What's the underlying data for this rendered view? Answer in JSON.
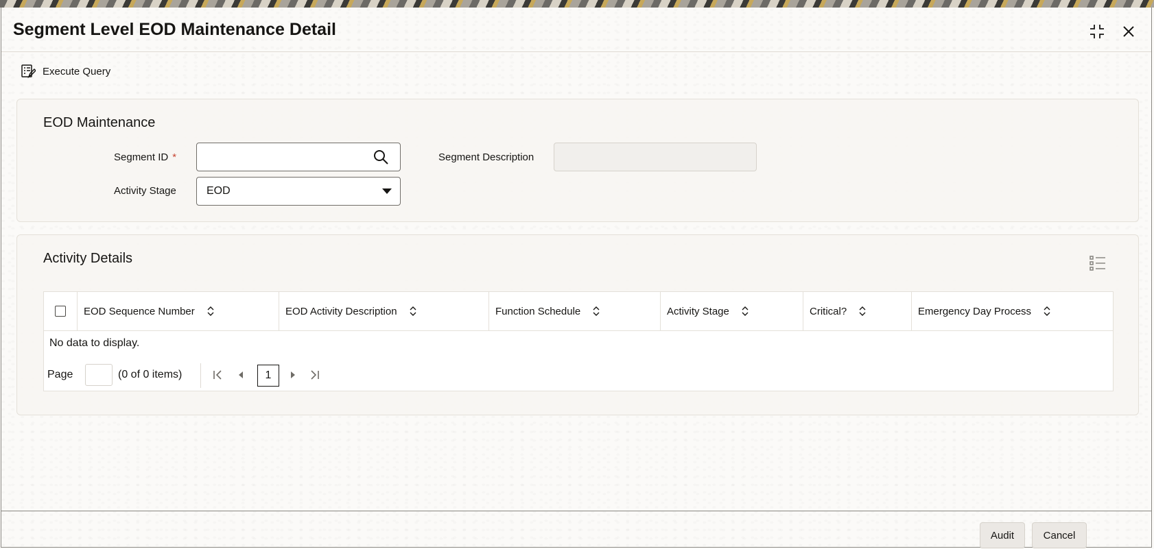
{
  "window": {
    "title": "Segment Level EOD Maintenance Detail",
    "maximize_icon": "maximize-icon",
    "close_icon": "close-icon"
  },
  "toolbar": {
    "execute_query_label": "Execute Query",
    "execute_query_icon": "query-form-icon"
  },
  "eod_maintenance": {
    "section_title": "EOD Maintenance",
    "segment_id_label": "Segment ID",
    "segment_id_required": "*",
    "segment_id_value": "",
    "segment_id_icon": "search-icon",
    "segment_description_label": "Segment Description",
    "segment_description_value": "",
    "activity_stage_label": "Activity Stage",
    "activity_stage_value": "EOD",
    "activity_stage_icon": "caret-down-icon"
  },
  "activity_details": {
    "section_title": "Activity Details",
    "column_manager_icon": "column-list-icon",
    "columns": [
      "EOD Sequence Number",
      "EOD Activity Description",
      "Function Schedule",
      "Activity Stage",
      "Critical?",
      "Emergency Day Process"
    ],
    "no_data_text": "No data to display.",
    "pagination": {
      "page_label": "Page",
      "page_input_value": "",
      "count_text": "(0 of 0 items)",
      "current_page": "1"
    }
  },
  "footer": {
    "audit_label": "Audit",
    "cancel_label": "Cancel"
  },
  "colors": {
    "accent_required": "#c74634",
    "text": "#161513",
    "panel_bg": "#f7f5f2"
  }
}
